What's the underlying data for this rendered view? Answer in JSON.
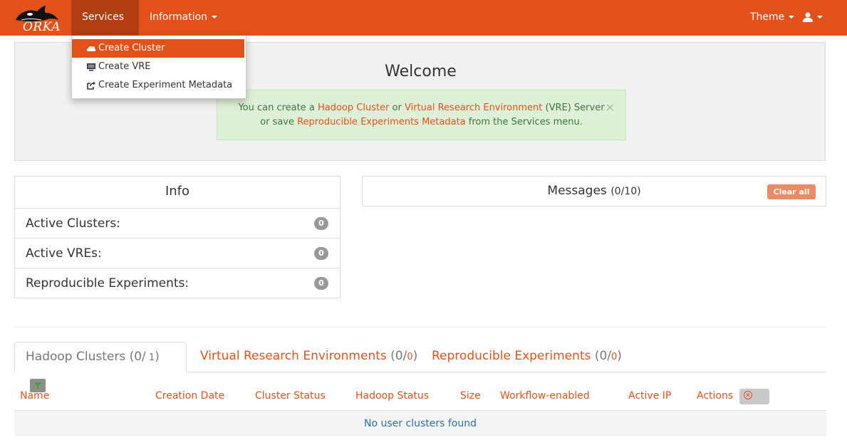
{
  "brand": {
    "name": "ORKA"
  },
  "navbar": {
    "services_label": "Services",
    "information_label": "Information",
    "theme_label": "Theme",
    "user_icon": "user-icon",
    "accent_color": "#e2511a"
  },
  "services_menu": {
    "items": [
      {
        "label": "Create Cluster",
        "icon": "cloud-icon"
      },
      {
        "label": "Create VRE",
        "icon": "monitor-icon"
      },
      {
        "label": "Create Experiment Metadata",
        "icon": "share-icon"
      }
    ]
  },
  "welcome": {
    "title": "Welcome",
    "alert": {
      "part1": "You can create a ",
      "link1": "Hadoop Cluster",
      "part2": " or ",
      "link2": "Virtual Research Environment",
      "part3": " (VRE) Server",
      "part4": "or save ",
      "link3": "Reproducible Experiments Metadata",
      "part5": " from the Services menu.",
      "close": "×"
    }
  },
  "info": {
    "title": "Info",
    "rows": [
      {
        "label": "Active Clusters:",
        "count": "0"
      },
      {
        "label": "Active VREs:",
        "count": "0"
      },
      {
        "label": "Reproducible Experiments:",
        "count": "0"
      }
    ]
  },
  "messages": {
    "title": "Messages",
    "count": "(0/10)",
    "clear_label": "Clear all"
  },
  "tabs": [
    {
      "label": "Hadoop Clusters",
      "open": "(0/",
      "num": " 1",
      "close": ")"
    },
    {
      "label": "Virtual Research Environments",
      "open": "(0/",
      "num": "0",
      "close": ")"
    },
    {
      "label": "Reproducible Experiments",
      "open": "(0/",
      "num": "0",
      "close": ")"
    }
  ],
  "table": {
    "columns": [
      "Name",
      "Creation Date",
      "Cluster Status",
      "Hadoop Status",
      "Size",
      "Workflow-enabled",
      "Active IP",
      "Actions"
    ],
    "empty_message": "No user clusters found"
  }
}
